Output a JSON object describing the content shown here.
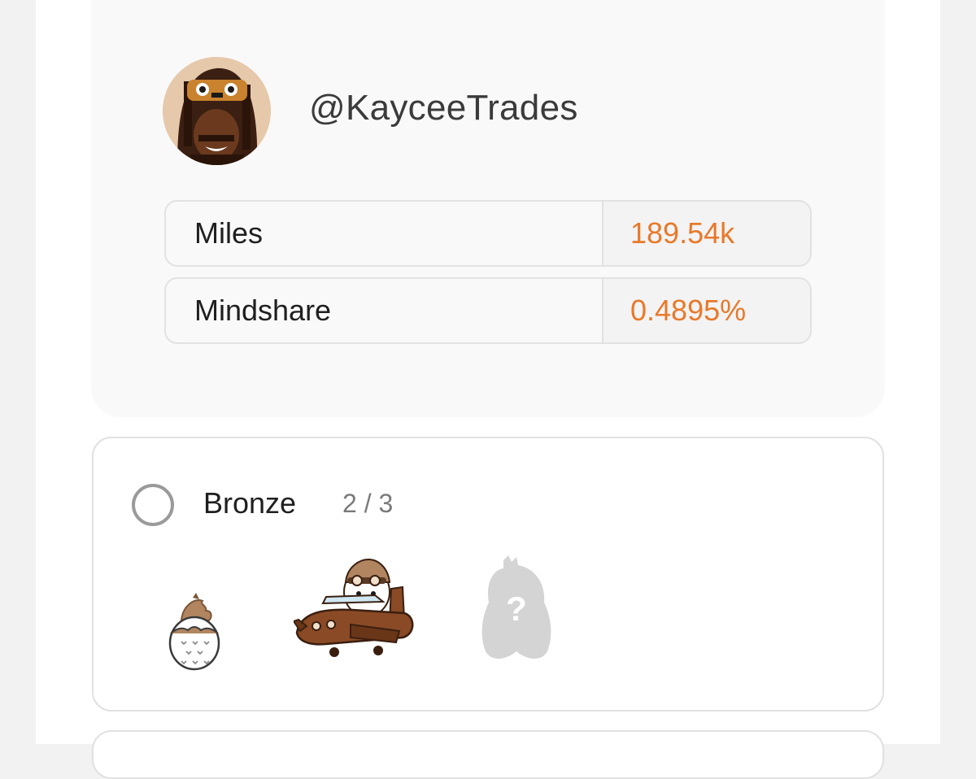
{
  "profile": {
    "username": "@KayceeTrades",
    "avatar_icon": "pixel-avatar-icon"
  },
  "stats": [
    {
      "label": "Miles",
      "value": "189.54k"
    },
    {
      "label": "Mindshare",
      "value": "0.4895%"
    }
  ],
  "tier": {
    "name": "Bronze",
    "progress": "2 / 3",
    "completed": 2,
    "total": 3,
    "badges": [
      {
        "icon": "egg-chick-badge-icon",
        "state": "unlocked"
      },
      {
        "icon": "pilot-owl-airplane-badge-icon",
        "state": "unlocked"
      },
      {
        "icon": "locked-mystery-bird-badge-icon",
        "state": "locked"
      }
    ]
  },
  "colors": {
    "accent": "#e8792a",
    "card_background": "#f9f9f9",
    "border": "#e2e2e2",
    "locked_badge": "#d4d4d4"
  }
}
